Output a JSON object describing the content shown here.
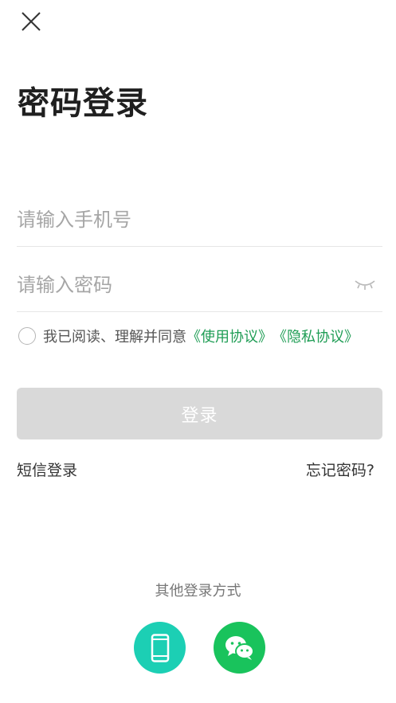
{
  "header": {
    "close_icon": "close-icon",
    "title": "密码登录"
  },
  "form": {
    "phone": {
      "placeholder": "请输入手机号",
      "value": ""
    },
    "password": {
      "placeholder": "请输入密码",
      "value": "",
      "toggle_icon": "eye-closed-icon"
    },
    "agreement": {
      "checked": false,
      "text": "我已阅读、理解并同意",
      "user_agreement": "《使用协议》",
      "privacy_policy": "《隐私协议》"
    },
    "login_button": "登录"
  },
  "links": {
    "sms_login": "短信登录",
    "forgot_password": "忘记密码?"
  },
  "other_login": {
    "title": "其他登录方式",
    "options": [
      {
        "icon": "mobile-phone-icon"
      },
      {
        "icon": "wechat-icon"
      }
    ]
  },
  "colors": {
    "brand_green": "#1f9d55",
    "login_disabled": "#d9d9d9",
    "phone_option": "#1ccfb4",
    "wechat_option": "#19c35c"
  }
}
